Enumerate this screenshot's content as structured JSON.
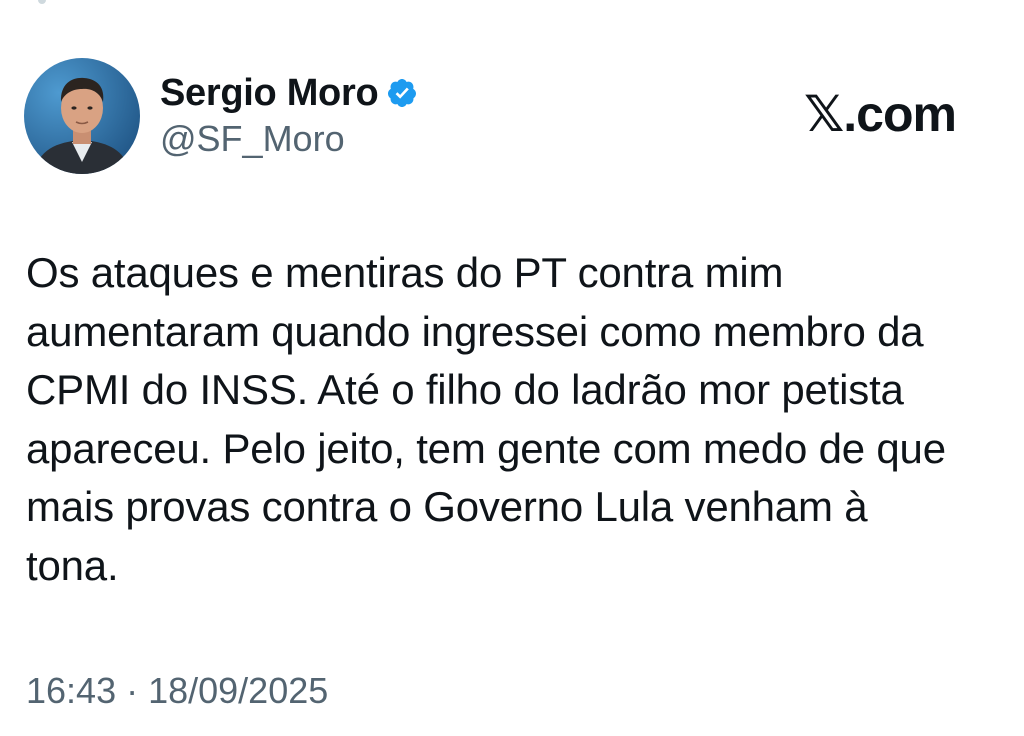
{
  "author": {
    "display_name": "Sergio Moro",
    "handle": "@SF_Moro",
    "verified": true,
    "verified_badge_color": "#1d9bf0"
  },
  "brand": {
    "label": "𝕏.com"
  },
  "tweet": {
    "lines": [
      "Os ataques e mentiras do PT contra mim",
      "aumentaram quando ingressei como membro da",
      "CPMI do INSS. Até o filho do ladrão mor petista",
      "apareceu. Pelo jeito, tem gente com medo de que",
      "mais provas contra o Governo Lula venham à",
      "tona."
    ],
    "timestamp": "16:43 · 18/09/2025"
  },
  "colors": {
    "text": "#0f1419",
    "secondary_text": "#536471",
    "background": "#ffffff"
  }
}
